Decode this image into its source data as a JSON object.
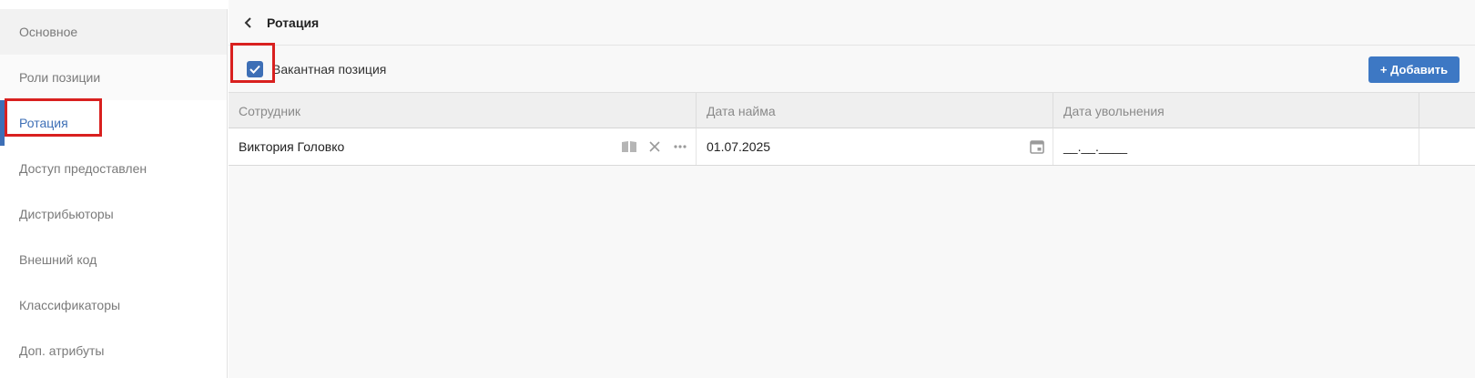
{
  "sidebar": {
    "items": [
      {
        "label": "Основное"
      },
      {
        "label": "Роли позиции"
      },
      {
        "label": "Ротация"
      },
      {
        "label": "Доступ предоставлен"
      },
      {
        "label": "Дистрибьюторы"
      },
      {
        "label": "Внешний код"
      },
      {
        "label": "Классификаторы"
      },
      {
        "label": "Доп. атрибуты"
      }
    ],
    "active_index": 2
  },
  "header": {
    "title": "Ротация",
    "back_icon": "chevron-left-icon"
  },
  "toolbar": {
    "vacant_checkbox": {
      "label": "Вакантная позиция",
      "checked": true
    },
    "add_button": "+ Добавить"
  },
  "table": {
    "columns": [
      "Сотрудник",
      "Дата найма",
      "Дата увольнения"
    ],
    "rows": [
      {
        "employee": "Виктория Головко",
        "hire_date": "01.07.2025",
        "dismissal_date": "__.__.____"
      }
    ],
    "row_icons": [
      "book-icon",
      "clear-icon",
      "more-icon",
      "calendar-icon"
    ]
  },
  "colors": {
    "accent": "#3d6fb6",
    "button": "#3d78c4",
    "highlight": "#d9201f"
  }
}
